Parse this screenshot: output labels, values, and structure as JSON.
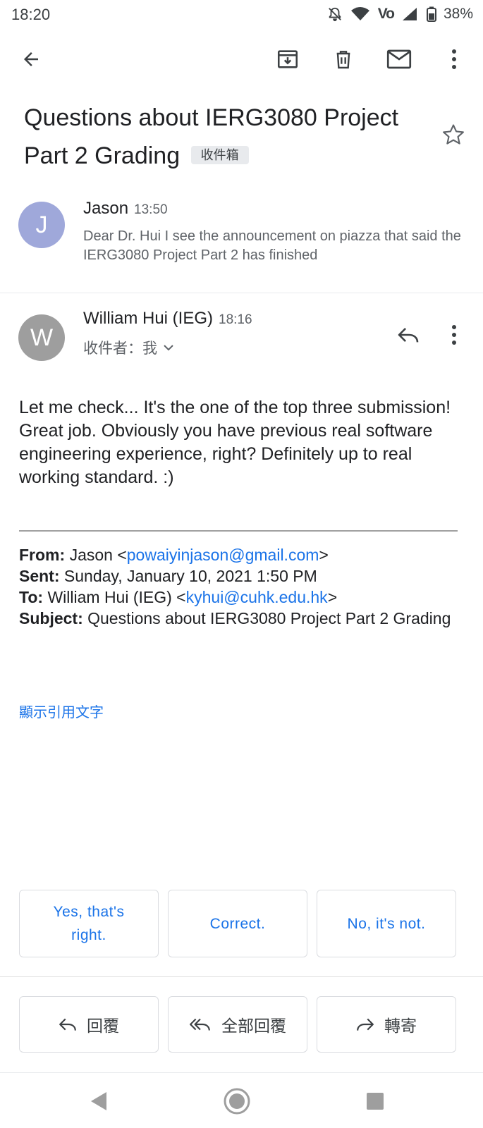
{
  "status_bar": {
    "time": "18:20",
    "network": "Vo",
    "battery": "38%"
  },
  "subject": {
    "title": "Questions about IERG3080 Project Part 2 Grading",
    "label": "收件箱"
  },
  "collapsed_message": {
    "avatar_letter": "J",
    "sender": "Jason",
    "time": "13:50",
    "snippet": "Dear Dr. Hui I see the announcement on piazza that said the IERG3080 Project Part 2 has finished"
  },
  "expanded_message": {
    "avatar_letter": "W",
    "sender": "William Hui (IEG)",
    "time": "18:16",
    "recipient_line": "收件者：我",
    "body": "Let me check... It's the one of the top three submission! Great job. Obviously you have previous real software engineering experience, right? Definitely up to real working standard. :)",
    "quoted": {
      "from_label": "From:",
      "from_name": "Jason <",
      "from_email": "powaiyinjason@gmail.com",
      "from_end": ">",
      "sent_label": "Sent:",
      "sent_value": "Sunday, January 10, 2021 1:50 PM",
      "to_label": "To:",
      "to_name": "William Hui (IEG) <",
      "to_email": "kyhui@cuhk.edu.hk",
      "to_end": ">",
      "subject_label": "Subject:",
      "subject_value": "Questions about IERG3080 Project Part 2 Grading"
    },
    "show_quoted": "顯示引用文字"
  },
  "smart_replies": [
    "Yes, that's right.",
    "Correct.",
    "No, it's not."
  ],
  "actions": {
    "reply": "回覆",
    "reply_all": "全部回覆",
    "forward": "轉寄"
  },
  "colors": {
    "accent": "#1a73e8",
    "avatar_j": "#9fa8da",
    "avatar_w": "#9e9e9e"
  },
  "icons": [
    "back-arrow-icon",
    "archive-icon",
    "delete-icon",
    "mail-icon",
    "more-vert-icon",
    "star-icon",
    "reply-icon",
    "reply-all-icon",
    "forward-icon"
  ]
}
